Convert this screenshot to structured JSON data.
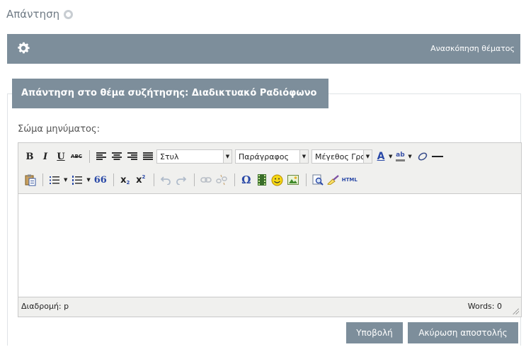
{
  "page": {
    "title": "Απάντηση"
  },
  "topbar": {
    "overview_link": "Ανασκόπηση θέματος"
  },
  "form": {
    "tab_title": "Απάντηση στο θέμα συζήτησης: Διαδικτυακό Ραδιόφωνο",
    "body_label": "Σώμα μηνύματος:"
  },
  "editor": {
    "toolbar": {
      "bold": "B",
      "italic": "I",
      "underline": "U",
      "strikethrough": "ABC",
      "style_select": "Στυλ",
      "format_select": "Παράγραφος",
      "fontsize_select": "Μέγεθος Γραμμ",
      "forecolor": "A",
      "backcolor": "ab",
      "blockquote": "66",
      "subscript": "x",
      "superscript": "x",
      "charmap": "Ω",
      "html": "HTML"
    },
    "status_path": "Διαδρομή: p",
    "word_count": "Words: 0"
  },
  "buttons": {
    "submit": "Υποβολή",
    "cancel": "Ακύρωση αποστολής"
  },
  "colors": {
    "accent_bar": "#7d8e9b",
    "page_bg": "#ffffff",
    "editor_toolbar_bg": "#f0f0ee"
  }
}
